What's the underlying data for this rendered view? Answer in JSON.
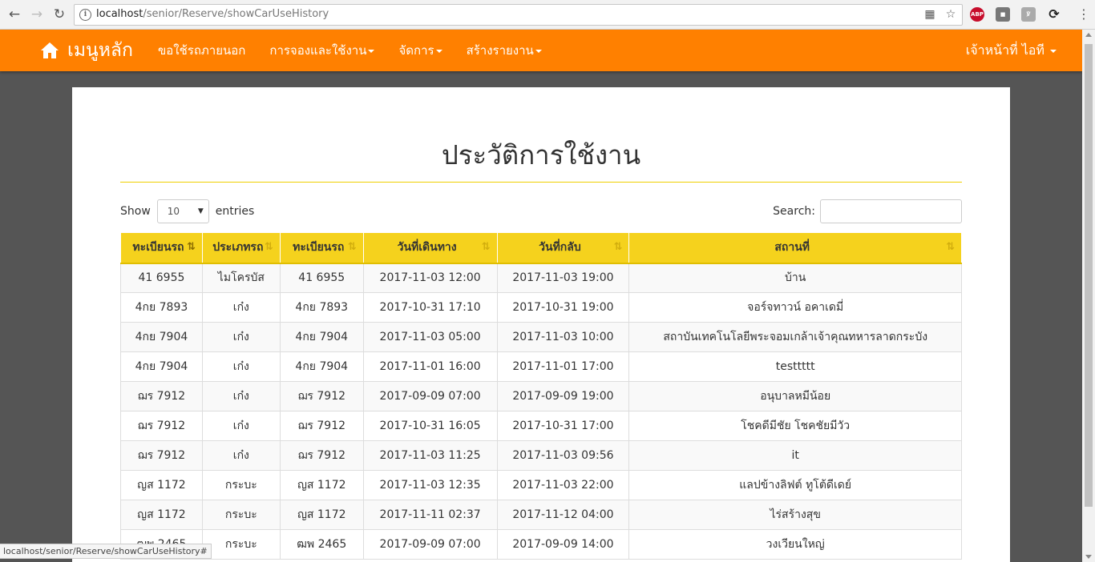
{
  "browser": {
    "url_host": "localhost",
    "url_path": "/senior/Reserve/showCarUseHistory",
    "status_url": "localhost/senior/Reserve/showCarUseHistory#"
  },
  "navbar": {
    "brand_label": "เมนูหลัก",
    "links": [
      "ขอใช้รถภายนอก",
      "การจองและใช้งาน",
      "จัดการ",
      "สร้างรายงาน"
    ],
    "user_label": "เจ้าหน้าที่ ไอที",
    "bg_color": "#ff8000"
  },
  "page": {
    "title": "ประวัติการใช้งาน",
    "show_label": "Show",
    "entries_label": "entries",
    "page_length": "10",
    "search_label": "Search:"
  },
  "table": {
    "headers": [
      "ทะเบียนรถ",
      "ประเภทรถ",
      "ทะเบียนรถ",
      "วันที่เดินทาง",
      "วันที่กลับ",
      "สถานที่"
    ],
    "header_color": "#f5d21d",
    "rows": [
      [
        "41 6955",
        "ไมโครบัส",
        "41 6955",
        "2017-11-03 12:00",
        "2017-11-03 19:00",
        "บ้าน"
      ],
      [
        "4กย 7893",
        "เก๋ง",
        "4กย 7893",
        "2017-10-31 17:10",
        "2017-10-31 19:00",
        "จอร์จทาวน์ อคาเดมี่"
      ],
      [
        "4กย 7904",
        "เก๋ง",
        "4กย 7904",
        "2017-11-03 05:00",
        "2017-11-03 10:00",
        "สถาบันเทคโนโลยีพระจอมเกล้าเจ้าคุณทหารลาดกระบัง"
      ],
      [
        "4กย 7904",
        "เก๋ง",
        "4กย 7904",
        "2017-11-01 16:00",
        "2017-11-01 17:00",
        "testtttt"
      ],
      [
        "ฌร 7912",
        "เก๋ง",
        "ฌร 7912",
        "2017-09-09 07:00",
        "2017-09-09 19:00",
        "อนุบาลหมีน้อย"
      ],
      [
        "ฌร 7912",
        "เก๋ง",
        "ฌร 7912",
        "2017-10-31 16:05",
        "2017-10-31 17:00",
        "โชคดีมีชัย โชคชัยมีวัว"
      ],
      [
        "ฌร 7912",
        "เก๋ง",
        "ฌร 7912",
        "2017-11-03 11:25",
        "2017-11-03 09:56",
        "it"
      ],
      [
        "ญส 1172",
        "กระบะ",
        "ญส 1172",
        "2017-11-03 12:35",
        "2017-11-03 22:00",
        "แลปข้างลิฟต์ ทูโต้ดีเดย์"
      ],
      [
        "ญส 1172",
        "กระบะ",
        "ญส 1172",
        "2017-11-11 02:37",
        "2017-11-12 04:00",
        "ไร่สร้างสุข"
      ],
      [
        "ฒพ 2465",
        "กระบะ",
        "ฒพ 2465",
        "2017-09-09 07:00",
        "2017-09-09 14:00",
        "วงเวียนใหญ่"
      ]
    ]
  }
}
